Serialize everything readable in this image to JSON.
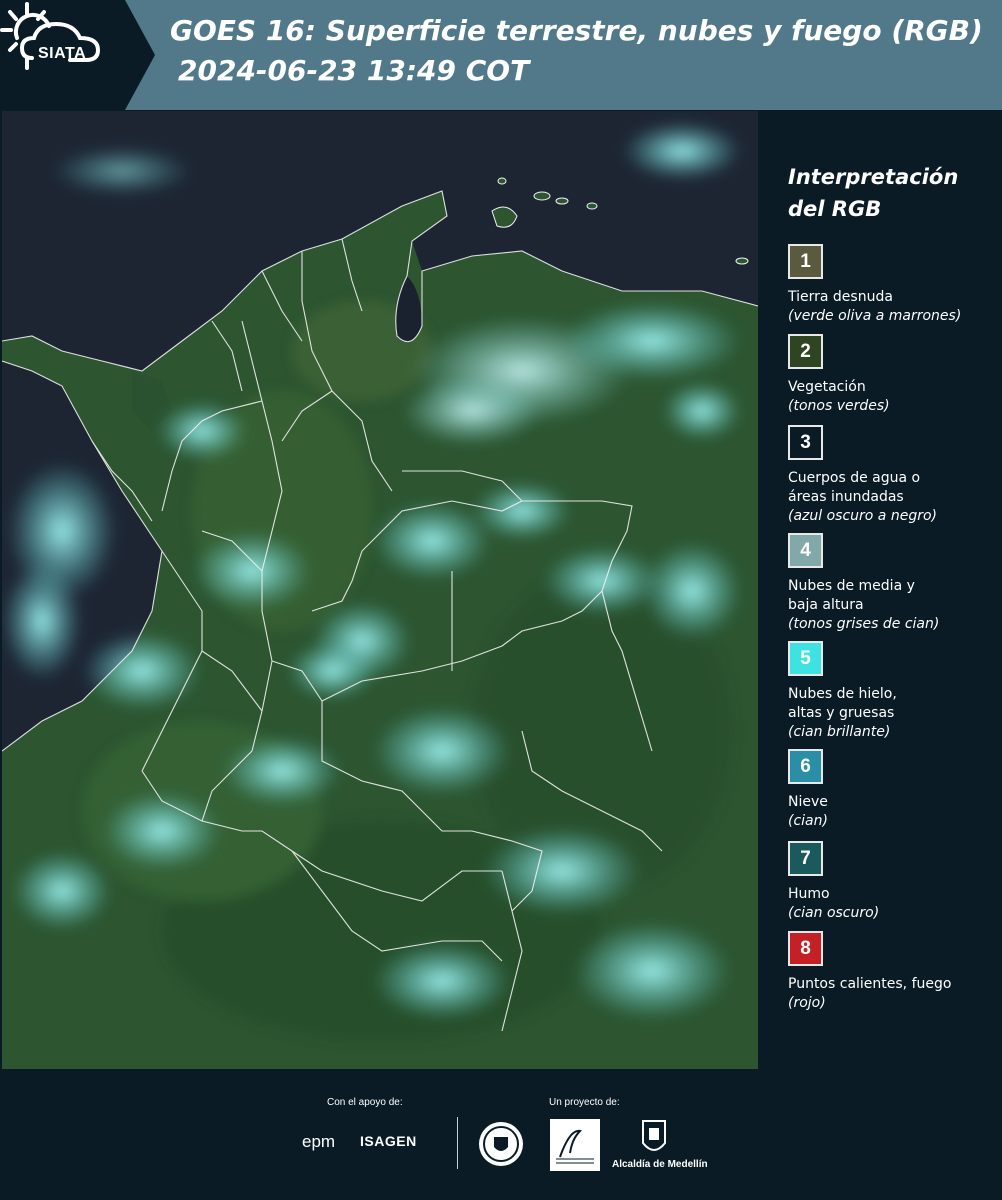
{
  "header": {
    "logo_text": "SIATA",
    "title": "GOES 16: Superficie terrestre, nubes y fuego (RGB)",
    "timestamp": "2024-06-23 13:49 COT"
  },
  "legend": {
    "title": "Interpretación del RGB",
    "items": [
      {
        "number": "1",
        "label": "Tierra desnuda",
        "desc": "(verde oliva a marrones)",
        "color": "#5b5a3e"
      },
      {
        "number": "2",
        "label": "Vegetación",
        "desc": "(tonos verdes)",
        "color": "#2f4421"
      },
      {
        "number": "3",
        "label": "Cuerpos de agua o áreas inundadas",
        "desc": "(azul oscuro a negro)",
        "color": "#0a1b26"
      },
      {
        "number": "4",
        "label": "Nubes de media y baja altura",
        "desc": "(tonos grises de cian)",
        "color": "#81a9a9"
      },
      {
        "number": "5",
        "label": "Nubes de hielo, altas y gruesas",
        "desc": "(cian brillante)",
        "color": "#3fe2e2"
      },
      {
        "number": "6",
        "label": "Nieve",
        "desc": "(cian)",
        "color": "#2a8ea6"
      },
      {
        "number": "7",
        "label": "Humo",
        "desc": "(cian oscuro)",
        "color": "#1b5a5c"
      },
      {
        "number": "8",
        "label": "Puntos calientes, fuego",
        "desc": "(rojo)",
        "color": "#c42126"
      }
    ]
  },
  "footer": {
    "support_label": "Con el apoyo de:",
    "project_label": "Un proyecto de:",
    "sponsors": [
      "epm",
      "ISAGEN"
    ],
    "partners": [
      "Área Metropolitana Valle de Aburrá",
      "Alcaldía de Medellín"
    ],
    "medellin_label": "Alcaldía de Medellín"
  },
  "map": {
    "description_icon": "satellite-rgb-image-colombia",
    "colors": {
      "ocean": "#1b2330",
      "vegetation": "#2e5a2e",
      "cloud": "#7fe0e0",
      "borders": "#ffffff"
    }
  }
}
